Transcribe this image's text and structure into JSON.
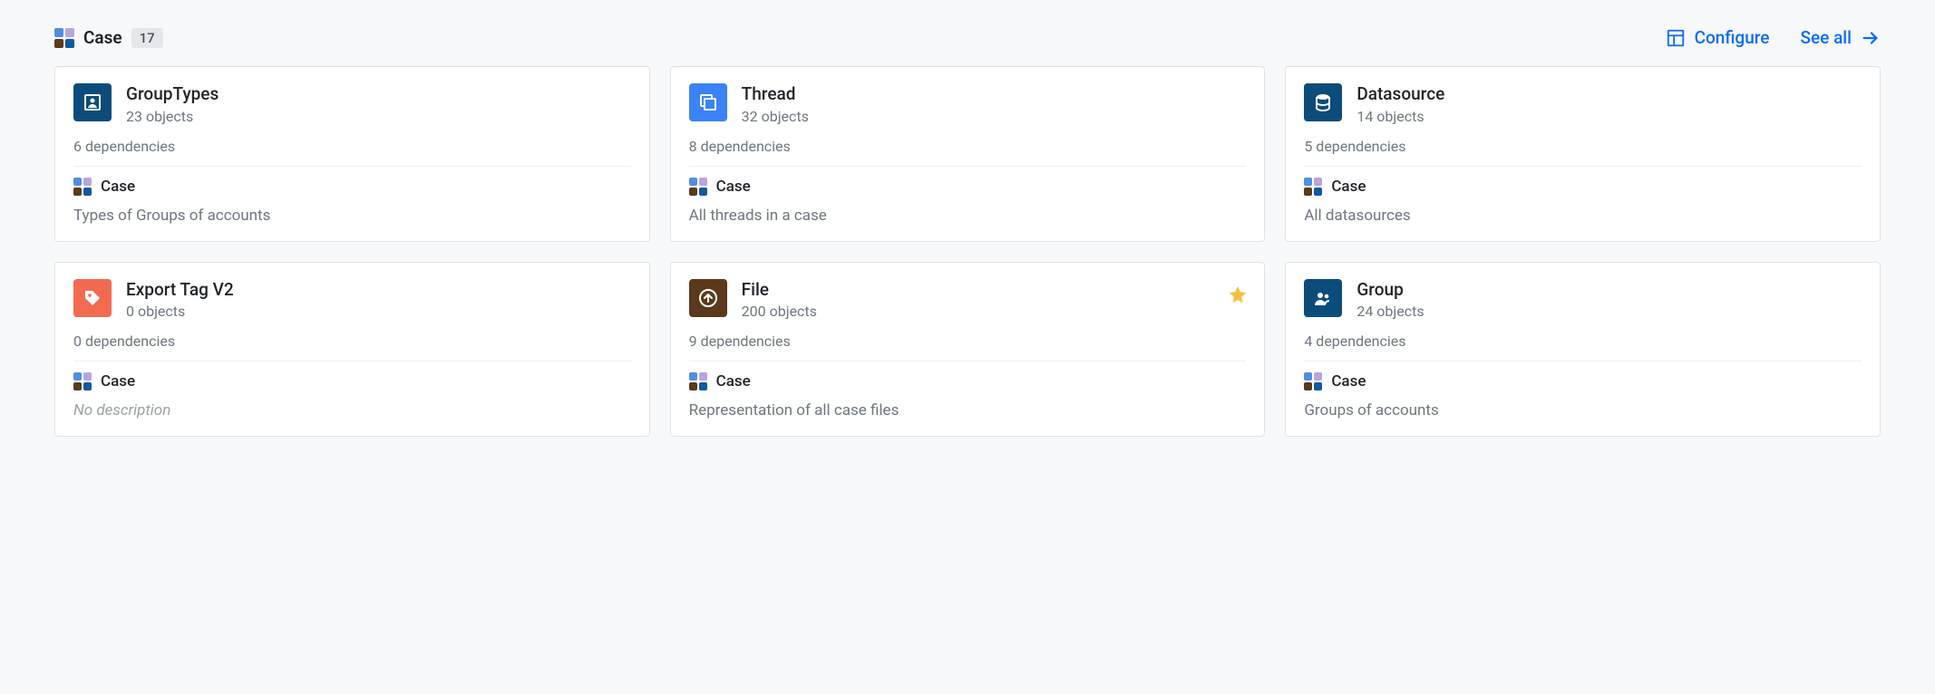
{
  "header": {
    "title": "Case",
    "count": "17",
    "configure_label": "Configure",
    "see_all_label": "See all"
  },
  "case_label": "Case",
  "no_description_label": "No description",
  "cards": [
    {
      "icon": "profile-frame",
      "icon_color": "darkblue",
      "title": "GroupTypes",
      "objects": "23 objects",
      "dependencies": "6 dependencies",
      "description": "Types of Groups of accounts",
      "starred": false
    },
    {
      "icon": "thread",
      "icon_color": "blue",
      "title": "Thread",
      "objects": "32 objects",
      "dependencies": "8 dependencies",
      "description": "All threads in a case",
      "starred": false
    },
    {
      "icon": "database",
      "icon_color": "darkblue",
      "title": "Datasource",
      "objects": "14 objects",
      "dependencies": "5 dependencies",
      "description": "All datasources",
      "starred": false
    },
    {
      "icon": "tag",
      "icon_color": "orange",
      "title": "Export Tag V2",
      "objects": "0 objects",
      "dependencies": "0 dependencies",
      "description": "",
      "starred": false
    },
    {
      "icon": "upload",
      "icon_color": "brown",
      "title": "File",
      "objects": "200 objects",
      "dependencies": "9 dependencies",
      "description": "Representation of all case files",
      "starred": true
    },
    {
      "icon": "group",
      "icon_color": "darkblue",
      "title": "Group",
      "objects": "24 objects",
      "dependencies": "4 dependencies",
      "description": "Groups of accounts",
      "starred": false
    }
  ]
}
